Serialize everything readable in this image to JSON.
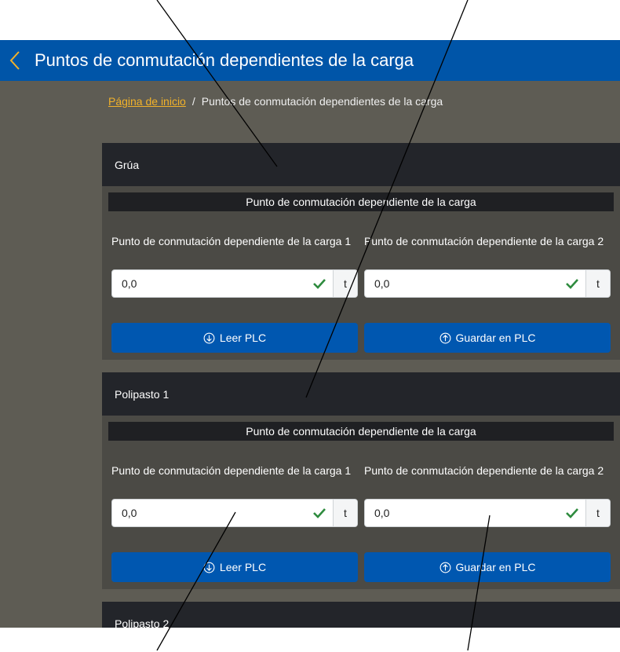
{
  "header": {
    "title": "Puntos de conmutación dependientes de la carga",
    "back_icon": "chevron-left-icon"
  },
  "breadcrumb": {
    "home": "Página de inicio",
    "separator": "/",
    "current": "Puntos de conmutación dependientes de la carga"
  },
  "sections": [
    {
      "title": "Grúa",
      "subtitle": "Punto de conmutación dependiente de la carga",
      "fields": [
        {
          "label": "Punto de conmutación dependiente de la carga 1",
          "value": "0,0",
          "unit": "t"
        },
        {
          "label": "Punto de conmutación dependiente de la carga 2",
          "value": "0,0",
          "unit": "t"
        }
      ],
      "read_button": "Leer PLC",
      "save_button": "Guardar en PLC"
    },
    {
      "title": "Polipasto 1",
      "subtitle": "Punto de conmutación dependiente de la carga",
      "fields": [
        {
          "label": "Punto de conmutación dependiente de la carga 1",
          "value": "0,0",
          "unit": "t"
        },
        {
          "label": "Punto de conmutación dependiente de la carga 2",
          "value": "0,0",
          "unit": "t"
        }
      ],
      "read_button": "Leer PLC",
      "save_button": "Guardar en PLC"
    },
    {
      "title": "Polipasto 2"
    }
  ],
  "colors": {
    "header": "#0055a8",
    "accent": "#f2b22a",
    "button": "#0057b0",
    "valid": "#2e8b3e"
  }
}
